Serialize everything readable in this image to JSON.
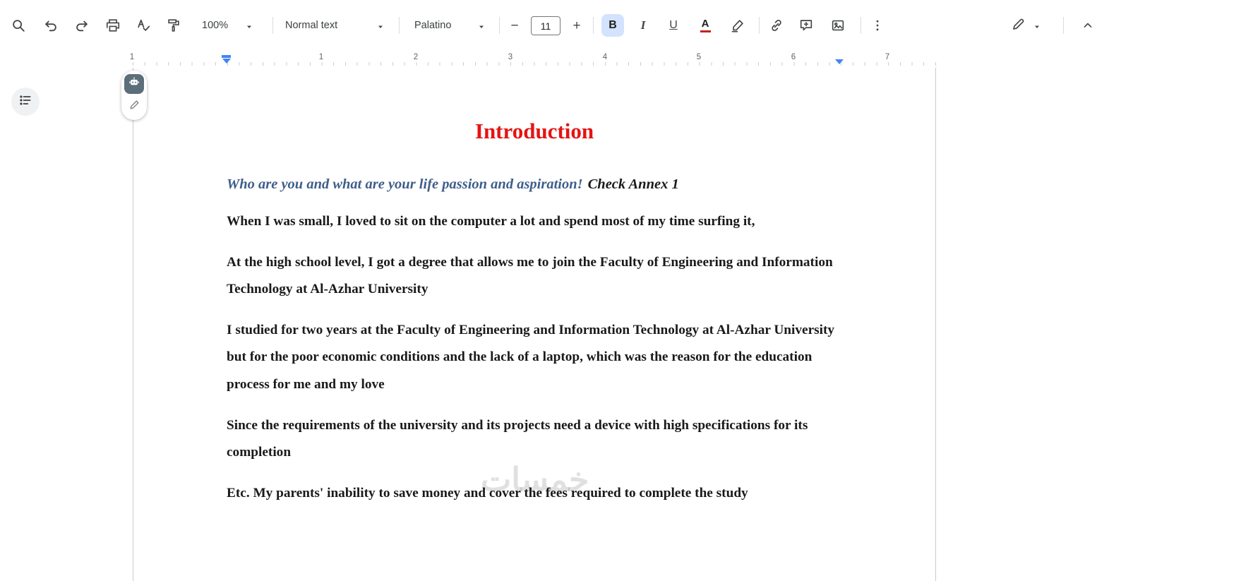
{
  "toolbar": {
    "zoom_value": "100%",
    "style_value": "Normal text",
    "font_value": "Palatino",
    "font_size_value": "11",
    "bold_label": "B",
    "italic_label": "I",
    "underline_label": "U",
    "text_color_label": "A",
    "spellcheck_letter": "A"
  },
  "ruler": {
    "numbers": [
      "1",
      "1",
      "2",
      "3",
      "4",
      "5",
      "6",
      "7"
    ]
  },
  "colors": {
    "accent_blue": "#4285f4",
    "bold_active_bg": "#d3e3fd",
    "text_color_bar": "#c5221f",
    "icon_gray": "#444746"
  },
  "document": {
    "title": "Introduction",
    "colors": {
      "title": "#e51313",
      "question": "#3f5e8a"
    },
    "question_blue": "Who are you and what are your life passion and aspiration!",
    "question_suffix": "Check Annex 1",
    "paragraphs": [
      "When I was small, I loved to sit on the computer a lot and spend most of my time surfing it,",
      "At the high school level, I got a degree that allows me to join the Faculty of Engineering and Information Technology at Al-Azhar University",
      "I studied for two years at the Faculty of Engineering and Information Technology at Al-Azhar University but for the poor economic conditions and the lack of a laptop, which was the reason for the education process for me and my love",
      "Since the requirements of the university and its projects need a device with high specifications for its completion",
      "Etc. My parents' inability to save money and cover the fees required to complete the study"
    ],
    "watermark": "خمسات"
  }
}
